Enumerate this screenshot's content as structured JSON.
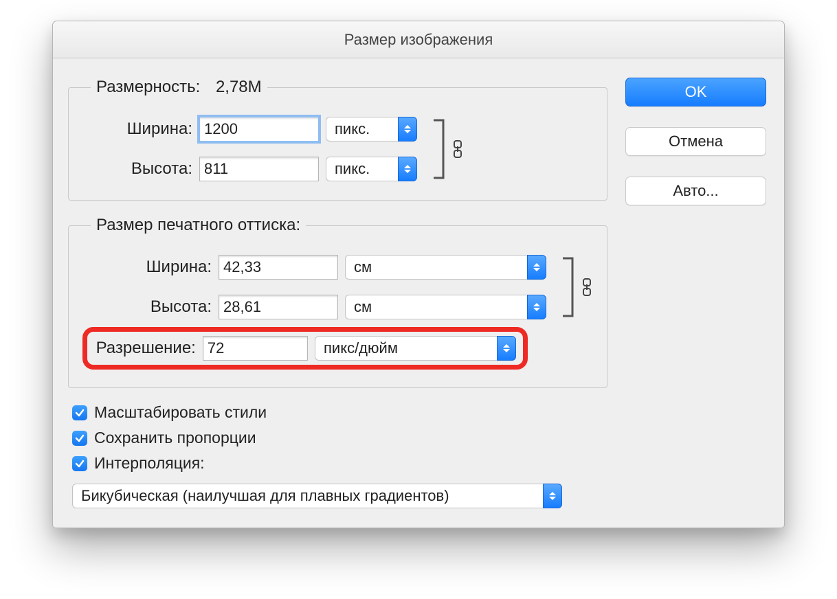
{
  "window": {
    "title": "Размер изображения"
  },
  "buttons": {
    "ok": "OK",
    "cancel": "Отмена",
    "auto": "Авто..."
  },
  "pixelDimensions": {
    "legendLabel": "Размерность:",
    "legendValue": "2,78M",
    "widthLabel": "Ширина:",
    "widthValue": "1200",
    "widthUnit": "пикс.",
    "heightLabel": "Высота:",
    "heightValue": "811",
    "heightUnit": "пикс."
  },
  "documentSize": {
    "legend": "Размер печатного оттиска:",
    "widthLabel": "Ширина:",
    "widthValue": "42,33",
    "widthUnit": "см",
    "heightLabel": "Высота:",
    "heightValue": "28,61",
    "heightUnit": "см",
    "resolutionLabel": "Разрешение:",
    "resolutionValue": "72",
    "resolutionUnit": "пикс/дюйм"
  },
  "checks": {
    "scaleStyles": "Масштабировать стили",
    "constrainProportions": "Сохранить пропорции",
    "resample": "Интерполяция:"
  },
  "interpolation": {
    "selected": "Бикубическая (наилучшая для плавных градиентов)"
  }
}
